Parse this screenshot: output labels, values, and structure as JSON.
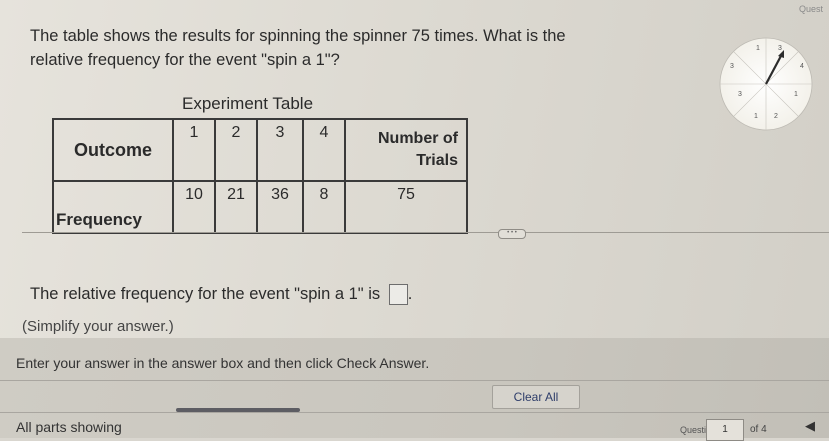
{
  "corner_tag": "Quest",
  "question": {
    "line1": "The table shows the results for spinning the spinner 75 times. What is the",
    "line2": "relative frequency for the event \"spin a 1\"?"
  },
  "spinner": {
    "labels": [
      "1",
      "3",
      "3",
      "4",
      "3",
      "1",
      "1",
      "2"
    ]
  },
  "table": {
    "title": "Experiment Table",
    "outcome_header": "Outcome",
    "outcomes": [
      "1",
      "2",
      "3",
      "4"
    ],
    "trials_header_line1": "Number of",
    "trials_header_line2": "Trials",
    "frequency_label": "Frequency",
    "frequencies": [
      "10",
      "21",
      "36",
      "8"
    ],
    "trials_value": "75"
  },
  "more_pill": "• • •",
  "answer": {
    "prefix": "The relative frequency for the event \"spin a 1\" is",
    "suffix": ".",
    "value": ""
  },
  "simplify": "(Simplify your answer.)",
  "instruction": "Enter your answer in the answer box and then click Check Answer.",
  "clear_all": "Clear All",
  "parts_showing": "All parts showing",
  "progress_fraction": 1.0,
  "question_nav": {
    "label": "Question",
    "current": "1",
    "of_total": "of 4",
    "prev": "◀"
  }
}
